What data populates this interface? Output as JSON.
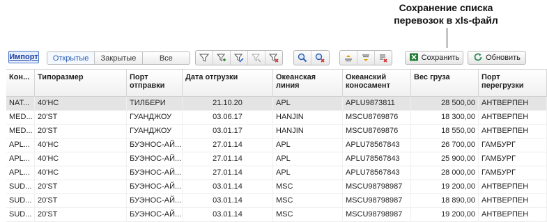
{
  "callout": {
    "line1": "Сохранение списка",
    "line2": "перевозок в xls-файл"
  },
  "toolbar": {
    "import_label": "Импорт",
    "segments": [
      "Открытые",
      "Закрытые",
      "Все"
    ],
    "save_label": "Сохранить",
    "refresh_label": "Обновить"
  },
  "colors": {
    "accent": "#2a5db0",
    "excel_green": "#1e7d32",
    "filter_red": "#d32f2f"
  },
  "icons": [
    "filter-icon",
    "filter-add-icon",
    "filter-edit-icon",
    "filter-disabled-icon",
    "filter-clear-icon",
    "search-icon",
    "search-clear-icon",
    "sort-asc-icon",
    "sort-desc-icon",
    "sort-clear-icon",
    "excel-icon",
    "refresh-icon"
  ],
  "table": {
    "headers": [
      "Кон...",
      "Типоразмер",
      "Порт отправки",
      "Дата отгрузки",
      "Океанская линия",
      "Океанский коносамент",
      "Вес груза",
      "Порт перегрузки"
    ],
    "rows": [
      [
        "NAT...",
        "40'HC",
        "ТИЛБЕРИ",
        "21.10.20",
        "APL",
        "APLU9873811",
        "28 500,00",
        "АНТВЕРПЕН"
      ],
      [
        "MED...",
        "20'ST",
        "ГУАНДЖОУ",
        "03.06.17",
        "HANJIN",
        "MSCU8769876",
        "18 300,00",
        "АНТВЕРПЕН"
      ],
      [
        "MED...",
        "20'ST",
        "ГУАНДЖОУ",
        "03.01.17",
        "HANJIN",
        "MSCU8769876",
        "18 550,00",
        "АНТВЕРПЕН"
      ],
      [
        "APL...",
        "40'HC",
        "БУЭНОС-АЙ...",
        "27.01.14",
        "APL",
        "APLU78567843",
        "26 700,00",
        "ГАМБУРГ"
      ],
      [
        "APL...",
        "40'HC",
        "БУЭНОС-АЙ...",
        "27.01.14",
        "APL",
        "APLU78567843",
        "25 900,00",
        "ГАМБУРГ"
      ],
      [
        "APL...",
        "40'HC",
        "БУЭНОС-АЙ...",
        "27.01.14",
        "APL",
        "APLU78567843",
        "28 000,00",
        "ГАМБУРГ"
      ],
      [
        "SUD...",
        "20'ST",
        "БУЭНОС-АЙ...",
        "03.01.14",
        "MSC",
        "MSCU98798987",
        "19 200,00",
        "АНТВЕРПЕН"
      ],
      [
        "SUD...",
        "20'ST",
        "БУЭНОС-АЙ...",
        "03.01.14",
        "MSC",
        "MSCU98798987",
        "18 890,00",
        "АНТВЕРПЕН"
      ],
      [
        "SUD...",
        "20'ST",
        "БУЭНОС-АЙ...",
        "03.01.14",
        "MSC",
        "MSCU98798987",
        "19 200,00",
        "АНТВЕРПЕН"
      ]
    ]
  }
}
